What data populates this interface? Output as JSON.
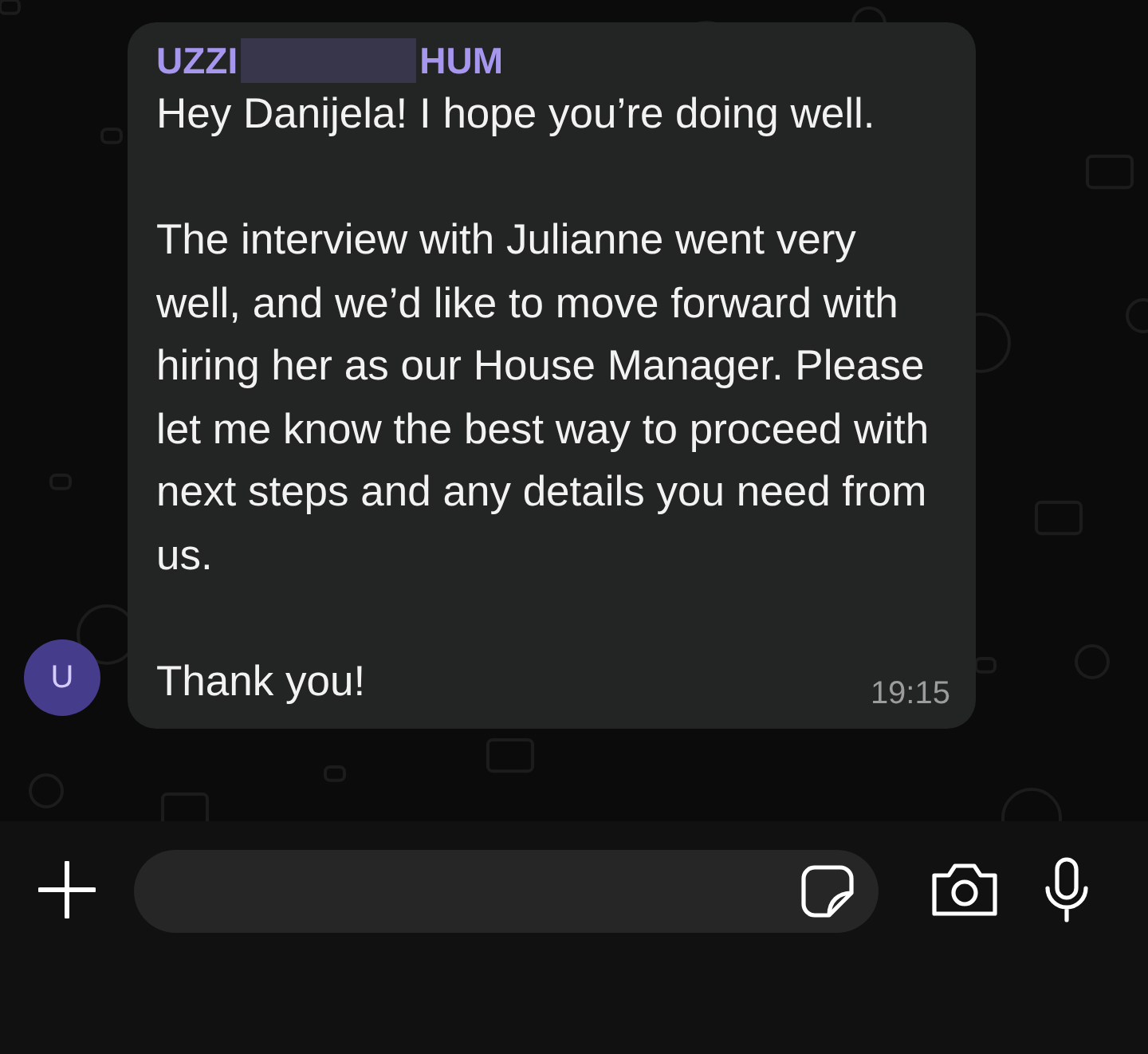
{
  "message": {
    "sender_name_start": "UZZI",
    "sender_name_end": "HUM",
    "paragraphs": [
      "Hey Danijela! I hope you’re doing well.",
      "The interview with Julianne went very well, and we’d like to move forward with hiring her as our House Manager. Please let me know the best way to proceed with next steps and any details you need from us.",
      "Thank you!"
    ],
    "time": "19:15",
    "avatar_letter": "U"
  },
  "composer": {
    "kind": "empty"
  }
}
